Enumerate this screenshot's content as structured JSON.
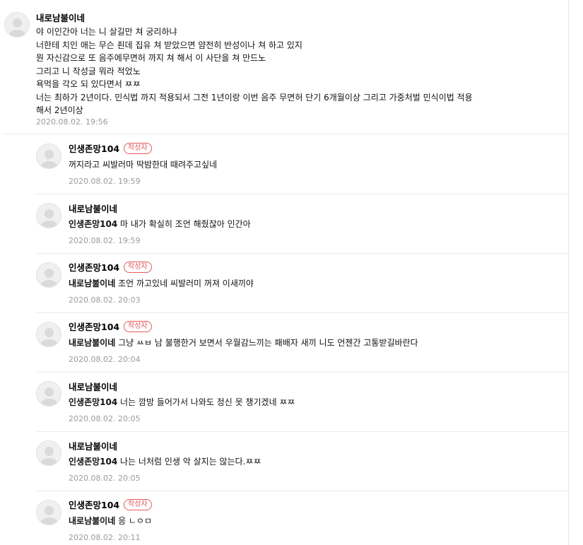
{
  "comments": [
    {
      "author": "내로남불이네",
      "lines": [
        "야 이인간아 너는 니 살길만 쳐 궁리하냐",
        "너한테 치인 애는 무슨 죈데 집유 쳐 받았으면 얌전히 반성이나 쳐 하고 있지",
        "뭔 자신감으로 또 음주에무면허 까지 쳐 해서 이 사단을 쳐 만드노",
        "그리고 니 작성글 뭐라 적었노",
        "욕먹을 각오 되 있다면서 ㅉㅉ",
        "너는 최하가 2년이다. 민식법 까지 적용되서 그전 1년이랑 이번 음주 무면허 단기 6개월이상 그리고 가중처벌 민식이법 적용",
        "해서 2년이상"
      ],
      "date": "2020.08.02. 19:56"
    }
  ],
  "replies": [
    {
      "author": "인생존망104",
      "badge": "작성자",
      "mention": "",
      "text": "꺼지라고 씨발러마 딱밤한대 때려주고싶네",
      "date": "2020.08.02. 19:59"
    },
    {
      "author": "내로남불이네",
      "badge": "",
      "mention": "인생존망104",
      "text": " 마 내가 확실히 조언 해줬잖아 인간아",
      "date": "2020.08.02. 19:59"
    },
    {
      "author": "인생존망104",
      "badge": "작성자",
      "mention": "내로남불이네",
      "text": " 조언 까고있네 씨발러미 꺼져 이새끼야",
      "date": "2020.08.02. 20:03"
    },
    {
      "author": "인생존망104",
      "badge": "작성자",
      "mention": "내로남불이네",
      "text": " 그냥 ㅆㅂ 남 불행한거 보면서 우월감느끼는 패배자 새끼 니도 언젠간 고통받길바란다",
      "date": "2020.08.02. 20:04"
    },
    {
      "author": "내로남불이네",
      "badge": "",
      "mention": "인생존망104",
      "text": " 너는 깜방 들어가서 나와도 정신 못 챙기겠네 ㅉㅉ",
      "date": "2020.08.02. 20:05"
    },
    {
      "author": "내로남불이네",
      "badge": "",
      "mention": "인생존망104",
      "text": " 나는 너처럼 인생 악 살지는 않는다.ㅉㅉ",
      "date": "2020.08.02. 20:05"
    },
    {
      "author": "인생존망104",
      "badge": "작성자",
      "mention": "내로남불이네",
      "text": " 응 ㄴㅇㅁ",
      "date": "2020.08.02. 20:11"
    }
  ]
}
